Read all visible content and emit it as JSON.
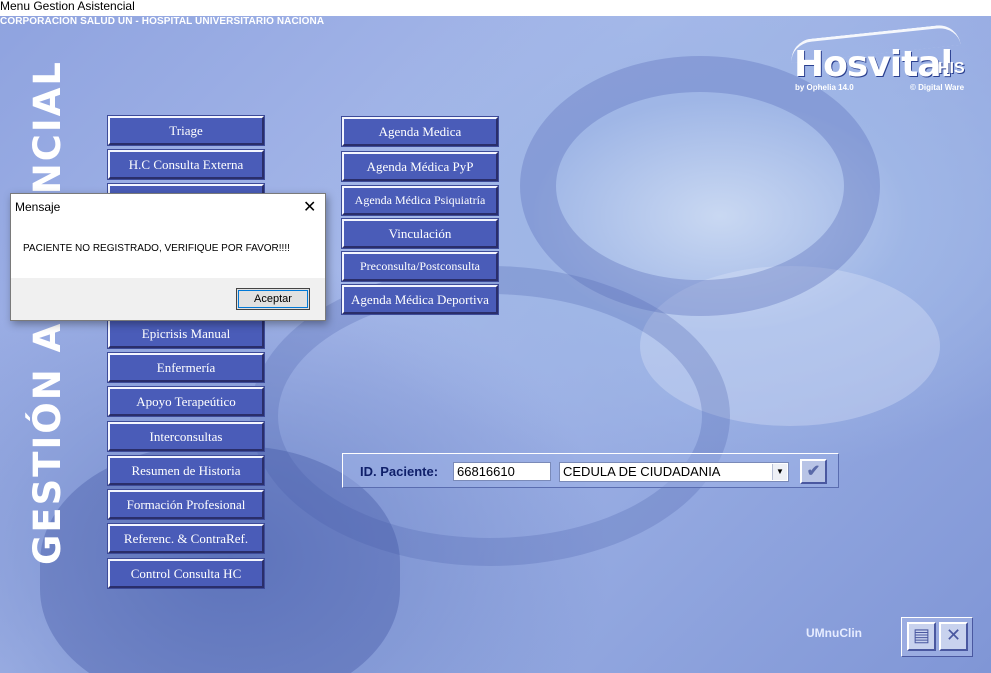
{
  "window": {
    "title": "Menu Gestion Asistencial",
    "hospital": "CORPORACION SALUD UN - HOSPITAL UNIVERSITARIO NACIONA"
  },
  "logo": {
    "name": "Hosvital",
    "suffix": "HIS",
    "byline": "by Ophelia 14.0",
    "vendor": "© Digital Ware"
  },
  "vertical_title": "GESTIÓN ASISTENCIAL",
  "menu_left": [
    {
      "label": "Triage",
      "icon": "button"
    },
    {
      "label": "H.C Consulta Externa",
      "icon": "button"
    },
    {
      "label": "",
      "icon": "button"
    },
    {
      "label": "",
      "icon": "button"
    },
    {
      "label": "",
      "icon": "button"
    },
    {
      "label": "",
      "icon": "button"
    },
    {
      "label": "Epicrisis Manual",
      "icon": "button"
    },
    {
      "label": "Enfermería",
      "icon": "button"
    },
    {
      "label": "Apoyo Terapeútico",
      "icon": "button"
    },
    {
      "label": "Interconsultas",
      "icon": "button"
    },
    {
      "label": "Resumen de Historia",
      "icon": "button"
    },
    {
      "label": "Formación Profesional",
      "icon": "button"
    },
    {
      "label": "Referenc. & ContraRef.",
      "icon": "button"
    },
    {
      "label": "Control Consulta HC",
      "icon": "button"
    }
  ],
  "menu_right": [
    {
      "label": "Agenda Medica"
    },
    {
      "label": "Agenda Médica PyP"
    },
    {
      "label": "Agenda Médica Psiquiatría"
    },
    {
      "label": "Vinculación"
    },
    {
      "label": "Preconsulta/Postconsulta"
    },
    {
      "label": "Agenda Médica Deportiva"
    }
  ],
  "patient": {
    "label": "ID. Paciente:",
    "id_value": "66816610",
    "doc_type": "CEDULA DE CIUDADANIA",
    "ok_icon": "checkmark-icon"
  },
  "footer": {
    "form_name": "UMnuClin",
    "print_icon": "printer-icon",
    "close_icon": "close-icon"
  },
  "dialog": {
    "title": "Mensaje",
    "message": "PACIENTE NO REGISTRADO, VERIFIQUE POR FAVOR!!!!",
    "button": "Aceptar"
  },
  "colors": {
    "button_bg": "#4a5cb8",
    "background": "#93a8e0",
    "accent": "#10206a"
  }
}
